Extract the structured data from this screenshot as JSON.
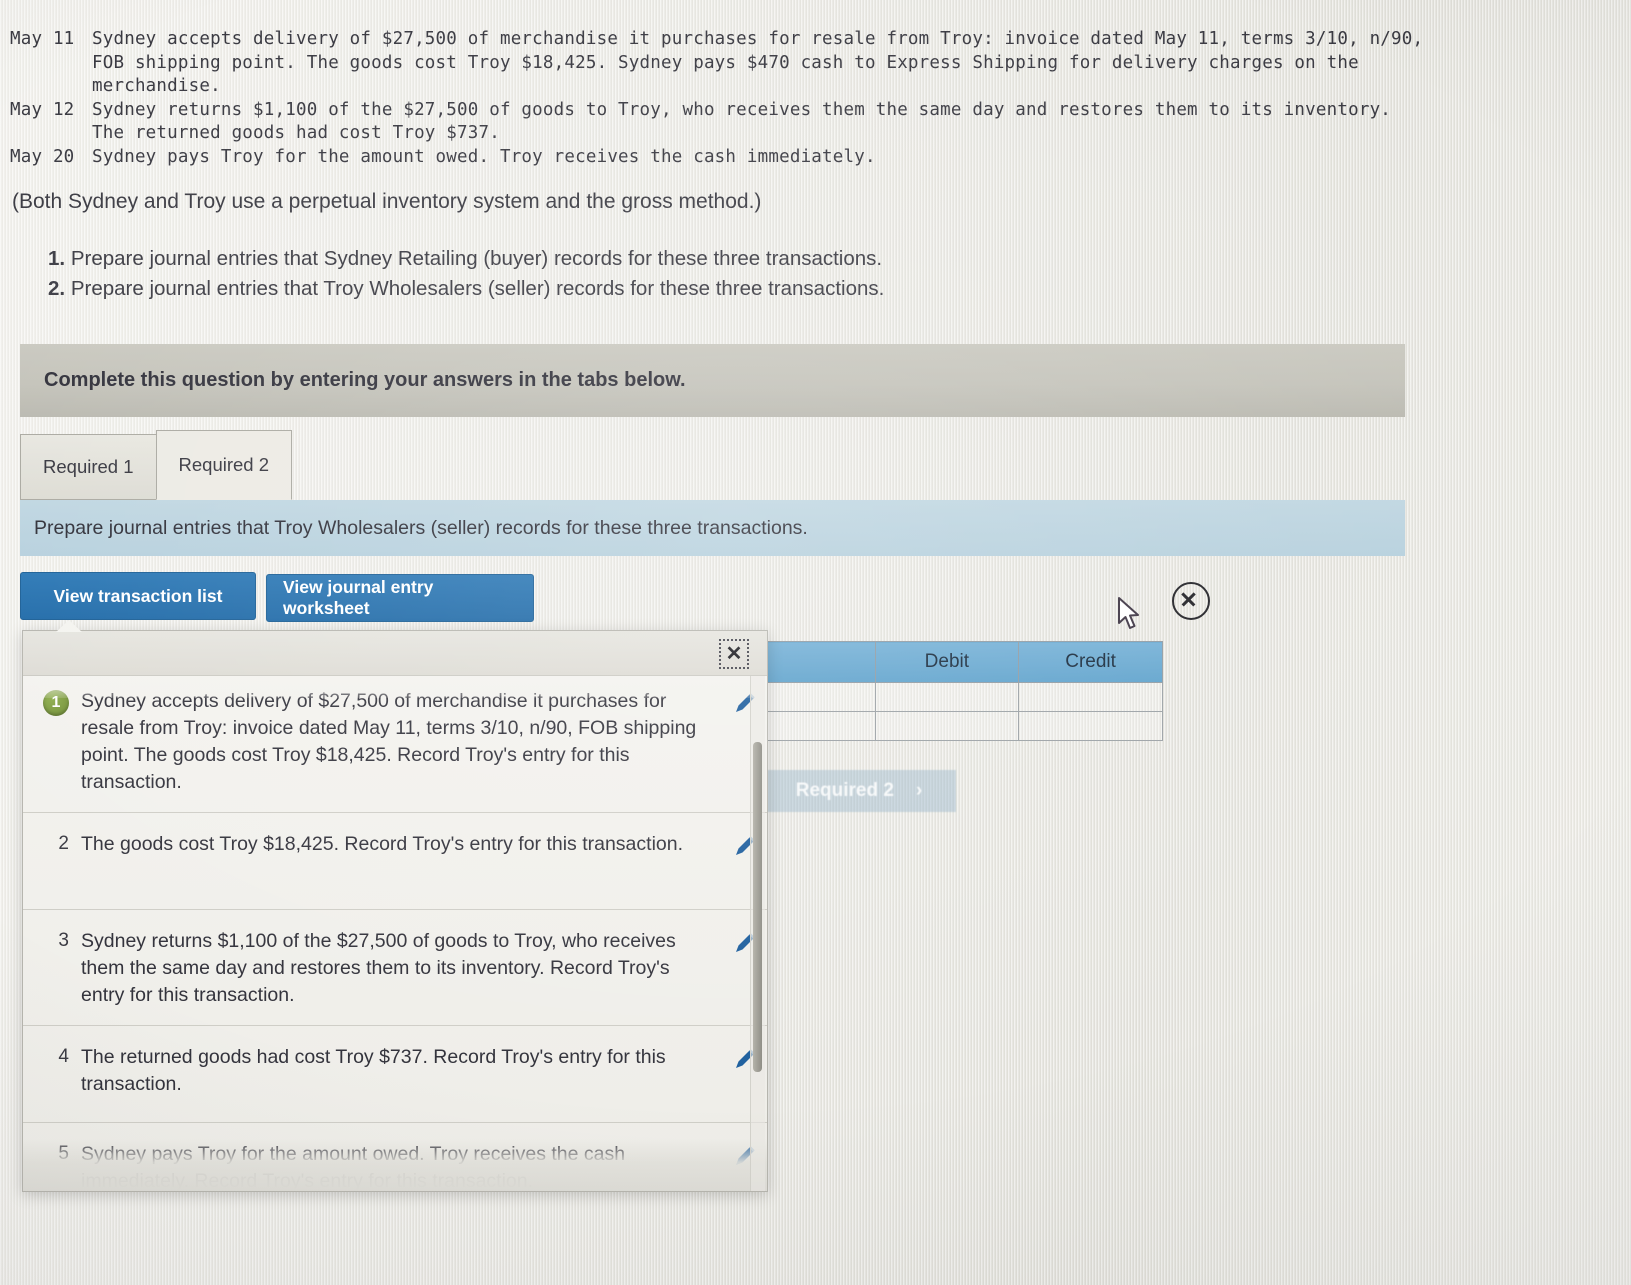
{
  "problem": {
    "entries": [
      {
        "date": "May 11",
        "text": "Sydney accepts delivery of $27,500 of merchandise it purchases for resale from Troy: invoice dated May 11, terms 3/10, n/90, FOB shipping point. The goods cost Troy $18,425. Sydney pays $470 cash to Express Shipping for delivery charges on the merchandise."
      },
      {
        "date": "May 12",
        "text": "Sydney returns $1,100 of the $27,500 of goods to Troy, who receives them the same day and restores them to its inventory. The returned goods had cost Troy $737."
      },
      {
        "date": "May 20",
        "text": "Sydney pays Troy for the amount owed. Troy receives the cash immediately."
      }
    ],
    "note": "(Both Sydney and Troy use a perpetual inventory system and the gross method.)",
    "requirements": [
      {
        "num": "1.",
        "text": "Prepare journal entries that Sydney Retailing (buyer) records for these three transactions."
      },
      {
        "num": "2.",
        "text": "Prepare journal entries that Troy Wholesalers (seller) records for these three transactions."
      }
    ]
  },
  "banner": {
    "text": "Complete this question by entering your answers in the tabs below."
  },
  "tabs": [
    {
      "label": "Required 1",
      "active": false
    },
    {
      "label": "Required 2",
      "active": true
    }
  ],
  "sub_instruction": {
    "text": "Prepare journal entries that Troy Wholesalers (seller) records for these three transactions."
  },
  "toolbar": {
    "view_transaction_list_label": "View transaction list",
    "view_journal_entry_worksheet_label": "View journal entry worksheet"
  },
  "worksheet": {
    "columns": [
      "",
      "Debit",
      "Credit"
    ],
    "empty_rows": 2,
    "next_button_label": "Required 2",
    "next_button_chevron": "›"
  },
  "modal": {
    "close_glyph": "✕",
    "transactions": [
      {
        "index": "1",
        "badge": true,
        "text": "Sydney accepts delivery of $27,500 of merchandise it purchases for resale from Troy: invoice dated May 11, terms 3/10, n/90, FOB shipping point. The goods cost Troy $18,425. Record Troy's entry for this transaction."
      },
      {
        "index": "2",
        "badge": false,
        "text": "The goods cost Troy $18,425. Record Troy's entry for this transaction."
      },
      {
        "index": "3",
        "badge": false,
        "text": "Sydney returns $1,100 of the $27,500 of goods to Troy, who receives them the same day and restores them to its inventory. Record Troy's entry for this transaction."
      },
      {
        "index": "4",
        "badge": false,
        "text": "The returned goods had cost Troy $737. Record Troy's entry for this transaction."
      },
      {
        "index": "5",
        "badge": false,
        "text": "Sydney pays Troy for the amount owed. Troy receives the cash immediately. Record Troy's entry for this transaction."
      }
    ]
  },
  "colors": {
    "button_blue": "#1f6aa8",
    "table_header_blue": "#5ea2cc",
    "sub_instruction_blue": "#b6d0dd",
    "banner_gray": "#c3c2b9",
    "badge_green": "#6e8c33",
    "pencil_blue": "#1e5f9e"
  }
}
